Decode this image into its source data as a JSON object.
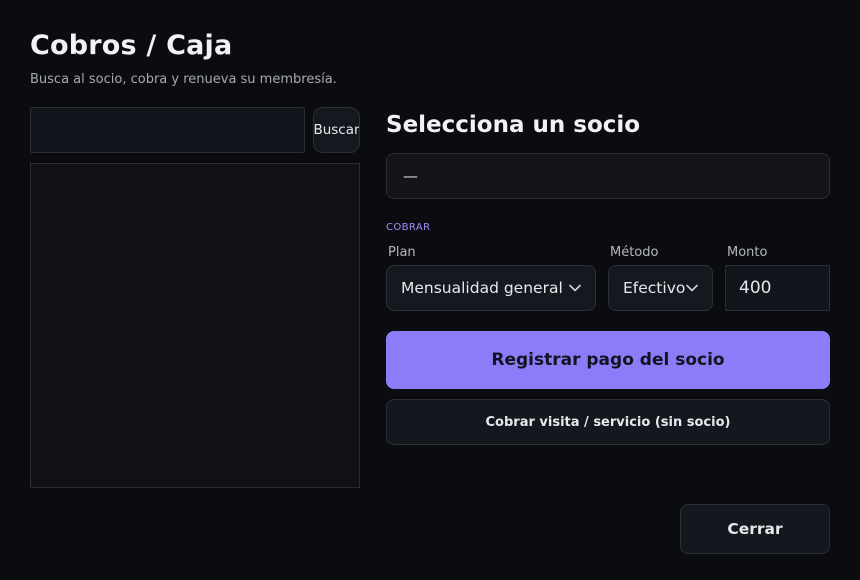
{
  "header": {
    "title": "Cobros / Caja",
    "subtitle": "Busca al socio, cobra y renueva su membresía."
  },
  "search": {
    "value": "",
    "button_label": "Buscar"
  },
  "member": {
    "heading": "Selecciona un socio",
    "selected_text": "—"
  },
  "charge": {
    "section_label": "COBRAR",
    "plan": {
      "label": "Plan",
      "value": "Mensualidad general"
    },
    "method": {
      "label": "Método",
      "value": "Efectivo"
    },
    "amount": {
      "label": "Monto",
      "value": "400"
    }
  },
  "actions": {
    "register_label": "Registrar pago del socio",
    "visit_label": "Cobrar visita / servicio (sin socio)",
    "close_label": "Cerrar"
  },
  "colors": {
    "background": "#0b0c10",
    "accent": "#8b7cf8",
    "section_label": "#a78bfa"
  },
  "icons": {
    "select_chevron": "chevron-down-icon"
  }
}
